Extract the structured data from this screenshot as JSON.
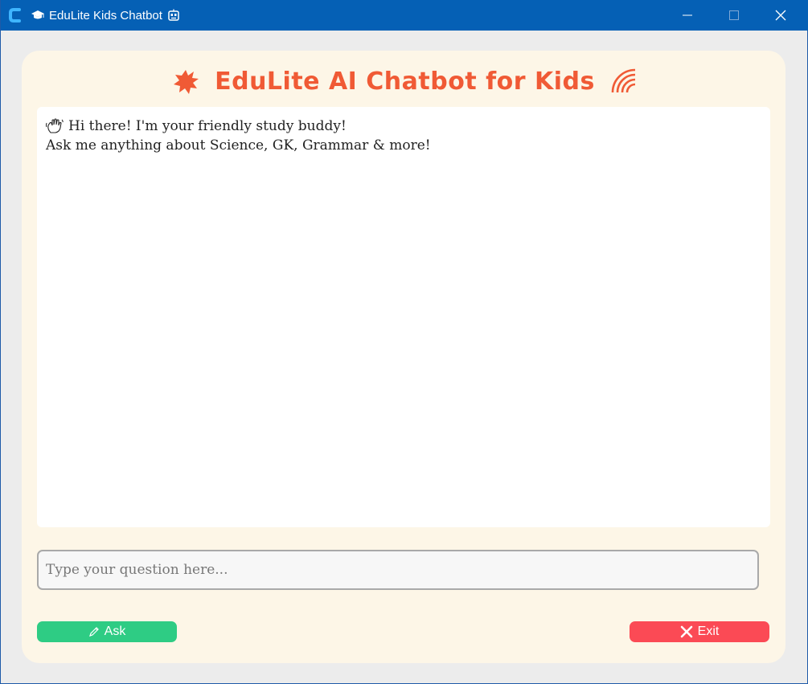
{
  "window": {
    "title": "EduLite Kids Chatbot",
    "title_prefix_icon": "graduation-cap-icon",
    "title_suffix_icon": "robot-face-icon",
    "accent": "#0560b5"
  },
  "header": {
    "title": "EduLite AI Chatbot for Kids",
    "left_icon": "splat-icon",
    "right_icon": "rainbow-icon",
    "color": "#f05a35"
  },
  "chat": {
    "messages": [
      {
        "icon": "waving-hand-icon",
        "text": "Hi there! I'm your friendly study buddy!"
      },
      {
        "icon": "",
        "text": "Ask me anything about Science, GK, Grammar & more!"
      }
    ]
  },
  "input": {
    "value": "",
    "placeholder": "Type your question here..."
  },
  "buttons": {
    "ask_label": "Ask",
    "ask_icon": "pencil-icon",
    "ask_color": "#2ecc84",
    "exit_label": "Exit",
    "exit_icon": "cross-mark-icon",
    "exit_color": "#fb4a55"
  }
}
